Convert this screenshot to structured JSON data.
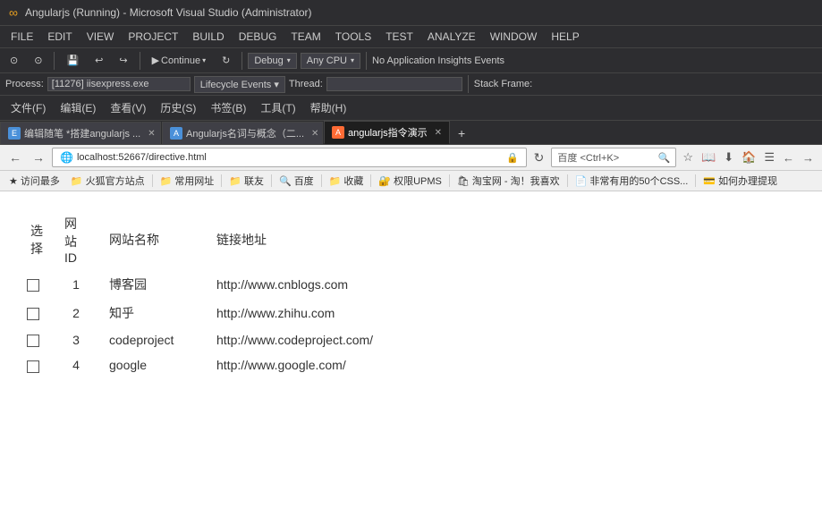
{
  "titleBar": {
    "icon": "▶",
    "text": "Angularjs (Running) - Microsoft Visual Studio (Administrator)"
  },
  "menuBar": {
    "items": [
      "FILE",
      "EDIT",
      "VIEW",
      "PROJECT",
      "BUILD",
      "DEBUG",
      "TEAM",
      "TOOLS",
      "TEST",
      "ANALYZE",
      "WINDOW",
      "HELP"
    ]
  },
  "toolbar": {
    "continue": "Continue",
    "debug": "Debug",
    "cpu": "Any CPU",
    "insights": "No Application Insights Events"
  },
  "processBar": {
    "processLabel": "Process:",
    "processValue": "[11276] iisexpress.exe",
    "lifecycleLabel": "Lifecycle Events ▾",
    "threadLabel": "Thread:",
    "stackLabel": "Stack Frame:"
  },
  "fileMenuBar": {
    "items": [
      "文件(F)",
      "编辑(E)",
      "查看(V)",
      "历史(S)",
      "书签(B)",
      "工具(T)",
      "帮助(H)"
    ]
  },
  "tabs": [
    {
      "label": "编辑随笔 *搭建angularjs ...",
      "favicon": "E",
      "active": false,
      "closable": true
    },
    {
      "label": "Angularjs名词与概念（二...",
      "favicon": "A",
      "active": false,
      "closable": true
    },
    {
      "label": "angularjs指令演示",
      "favicon": "A",
      "active": true,
      "closable": true
    }
  ],
  "tabNewLabel": "+",
  "browserToolbar": {
    "backBtn": "←",
    "forwardBtn": "→",
    "address": "localhost:52667/directive.html",
    "searchPlaceholder": "百度 <Ctrl+K>",
    "lockIcon": "🔒",
    "refreshIcon": "↻"
  },
  "favoritesBar": {
    "items": [
      {
        "label": "访问最多",
        "icon": "★"
      },
      {
        "label": "火狐官方站点",
        "icon": "🦊"
      },
      {
        "label": "常用网址",
        "icon": "📁"
      },
      {
        "label": "联友",
        "icon": "📁"
      },
      {
        "label": "百度",
        "icon": "🔍"
      },
      {
        "label": "收藏",
        "icon": "📁"
      },
      {
        "label": "权限UPMS",
        "icon": "📁"
      },
      {
        "label": "淘宝网 - 淘！我喜欢",
        "icon": "🛍"
      },
      {
        "label": "非常有用的50个CSS...",
        "icon": "📄"
      },
      {
        "label": "如何办理提现",
        "icon": "💰"
      }
    ]
  },
  "table": {
    "headers": [
      "选择",
      "网站ID",
      "网站名称",
      "链接地址"
    ],
    "rows": [
      {
        "selected": false,
        "id": "1",
        "name": "博客园",
        "url": "http://www.cnblogs.com"
      },
      {
        "selected": false,
        "id": "2",
        "name": "知乎",
        "url": "http://www.zhihu.com"
      },
      {
        "selected": false,
        "id": "3",
        "name": "codeproject",
        "url": "http://www.codeproject.com/"
      },
      {
        "selected": false,
        "id": "4",
        "name": "google",
        "url": "http://www.google.com/"
      }
    ]
  }
}
